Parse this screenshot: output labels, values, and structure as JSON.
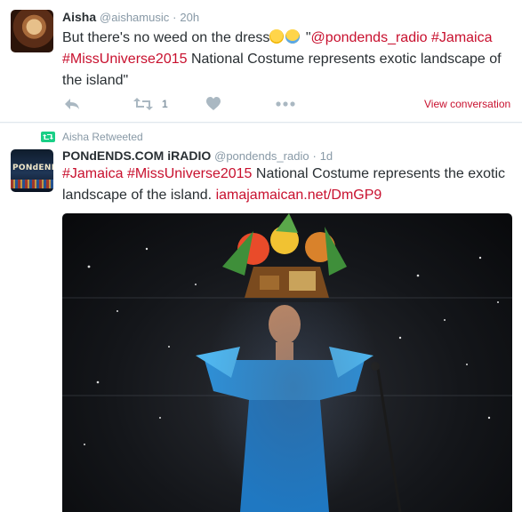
{
  "tweet1": {
    "name": "Aisha",
    "handle": "@aishamusic",
    "separator": "·",
    "time": "20h",
    "text_lead": "But there's no weed on the dress",
    "text_quote_open": " \"",
    "mention": "@pondends_radio",
    "hashtag1": "#Jamaica",
    "hashtag2": "#MissUniverse2015",
    "text_tail": " National Costume represents exotic landscape of the island\"",
    "retweet_count": "1",
    "view_conversation": "View conversation"
  },
  "retweet_notice": "Aisha Retweeted",
  "tweet2": {
    "name": "PONdENDS.COM iRADIO",
    "handle": "@pondends_radio",
    "separator": "·",
    "time": "1d",
    "hashtag1": "#Jamaica",
    "hashtag2": "#MissUniverse2015",
    "text_body": "  National Costume represents the exotic landscape of the island. ",
    "link": "iamajamaican.net/DmGP9",
    "avatar_text": "PONdENDS"
  },
  "colors": {
    "accent": "#c8102e",
    "muted": "#8899a6",
    "icon": "#aab8c2",
    "text": "#292f33"
  },
  "icons": [
    "reply-icon",
    "retweet-icon",
    "heart-icon",
    "more-icon",
    "retweet-small-icon",
    "wink-emoji",
    "crying-laughing-emoji"
  ]
}
